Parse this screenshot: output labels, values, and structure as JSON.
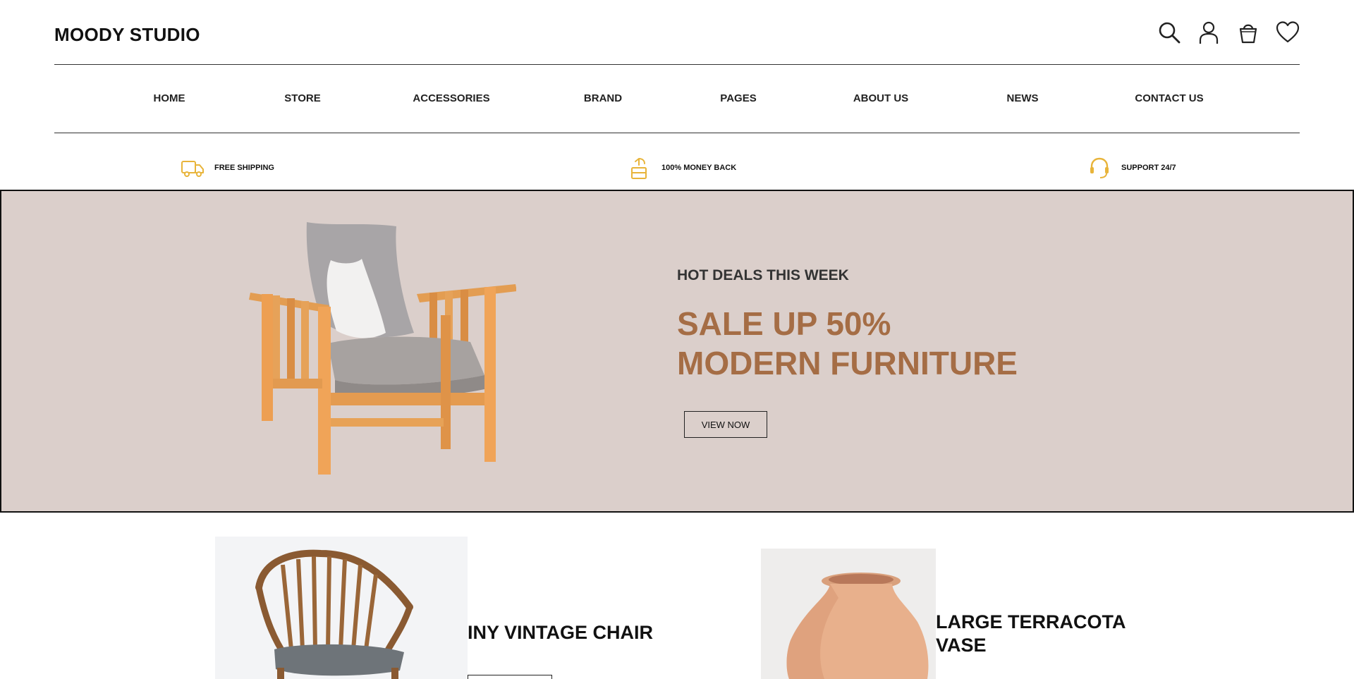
{
  "header": {
    "brand": "MOODY STUDIO"
  },
  "icons": {
    "search": "search-icon",
    "account": "user-icon",
    "cart": "basket-icon",
    "wishlist": "heart-icon"
  },
  "nav": {
    "items": [
      {
        "label": "HOME"
      },
      {
        "label": "STORE"
      },
      {
        "label": "ACCESSORIES"
      },
      {
        "label": "BRAND"
      },
      {
        "label": "PAGES"
      },
      {
        "label": "ABOUT US"
      },
      {
        "label": "NEWS"
      },
      {
        "label": "CONTACT US"
      }
    ]
  },
  "features": [
    {
      "label": "FREE SHIPPING",
      "icon": "truck-icon"
    },
    {
      "label": "100% MONEY BACK",
      "icon": "money-back-icon"
    },
    {
      "label": "SUPPORT 24/7",
      "icon": "headset-icon"
    }
  ],
  "hero": {
    "subtitle": "HOT DEALS THIS WEEK",
    "title_line1": "SALE UP 50%",
    "title_line2": "MODERN FURNITURE",
    "button": "VIEW NOW"
  },
  "products": [
    {
      "name": "INY VINTAGE CHAIR"
    },
    {
      "name_line1": "LARGE TERRACOTA",
      "name_line2": "VASE"
    }
  ],
  "colors": {
    "accent": "#a56d45",
    "hero_bg": "#dbcfcb",
    "icon_yellow": "#e8b43a"
  }
}
